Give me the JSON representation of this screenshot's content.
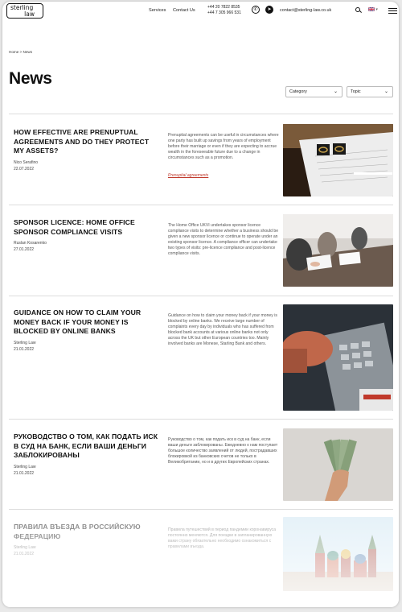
{
  "header": {
    "logo_line1": "sterling",
    "logo_line2": "law",
    "nav": [
      "Services",
      "Contact Us"
    ],
    "phone1": "+44 20 7822 8535",
    "phone2": "+44 7 305 966 531",
    "email": "contact@sterling-law.co.uk",
    "icons": [
      "whatsapp-icon",
      "telegram-icon",
      "search-icon",
      "flag-uk-icon",
      "menu-icon"
    ],
    "lang_arrow": "▾"
  },
  "breadcrumb": {
    "home": "Home",
    "sep": ">",
    "current": "News"
  },
  "page_title": "News",
  "filters": {
    "category": "Category",
    "topic": "Topic"
  },
  "articles": [
    {
      "title": "HOW EFFECTIVE ARE PRENUPTUAL AGREEMENTS AND DO THEY PROTECT MY ASSETS?",
      "author": "Nico Serafino",
      "date": "22.07.2022",
      "excerpt": "Prenuptial agreements can be useful in circumstances where one party has built up savings from years of employment before their marriage or even if they are expecting to accrue wealth in the foreseeable future due to a change in circumstances such as a promotion.",
      "tag": "Prenuptial agreements"
    },
    {
      "title": "SPONSOR LICENCE: HOME OFFICE SPONSOR COMPLIANCE VISITS",
      "author": "Ruslan Kosarenko",
      "date": "27.01.2022",
      "excerpt": "The Home Office UKVI undertakes sponsor licence compliance visits to determine whether a business should be given a new sponsor licence or continue to operate under an existing sponsor licence. A compliance officer can undertake two types of visits: pre-licence compliance and post-licence compliance visits.",
      "tag": ""
    },
    {
      "title": "GUIDANCE ON HOW TO CLAIM YOUR MONEY BACK IF YOUR MONEY IS BLOCKED BY ONLINE BANKS",
      "author": "Sterling Law",
      "date": "21.01.2022",
      "excerpt": "Guidance on how to claim your money back if your money is blocked by online banks. We receive large number of complaints every day by individuals who has suffered from blocked bank accounts at various online banks not only across the UK but other European countries too. Mainly involved banks are Monese, Starling Bank and others.",
      "tag": ""
    },
    {
      "title": "РУКОВОДСТВО О ТОМ, КАК ПОДАТЬ ИСК В СУД НА БАНК, ЕСЛИ ВАШИ ДЕНЬГИ ЗАБЛОКИРОВАНЫ",
      "author": "Sterling Law",
      "date": "21.01.2022",
      "excerpt": "Руководство о том, как подать иск в суд на банк, если ваши деньги заблокированы. Ежедневно к нам поступает большое количество заявлений от людей, пострадавших блокировкой из банковских счетов не только в Великобритании, но и в других Европейских странах.",
      "tag": ""
    },
    {
      "title": "ПРАВИЛА ВЪЕЗДА В РОССИЙСКУЮ ФЕДЕРАЦИЮ",
      "author": "Sterling Law",
      "date": "21.01.2022",
      "excerpt": "Правила путешествий в период пандемии коронавируса постоянно меняются. Для поездки в запланированную вами страну обязательно необходимо ознакомиться с правилами въезда.",
      "tag": ""
    }
  ],
  "colors": {
    "accent": "#c0392b",
    "text": "#111111",
    "muted": "#555555"
  }
}
